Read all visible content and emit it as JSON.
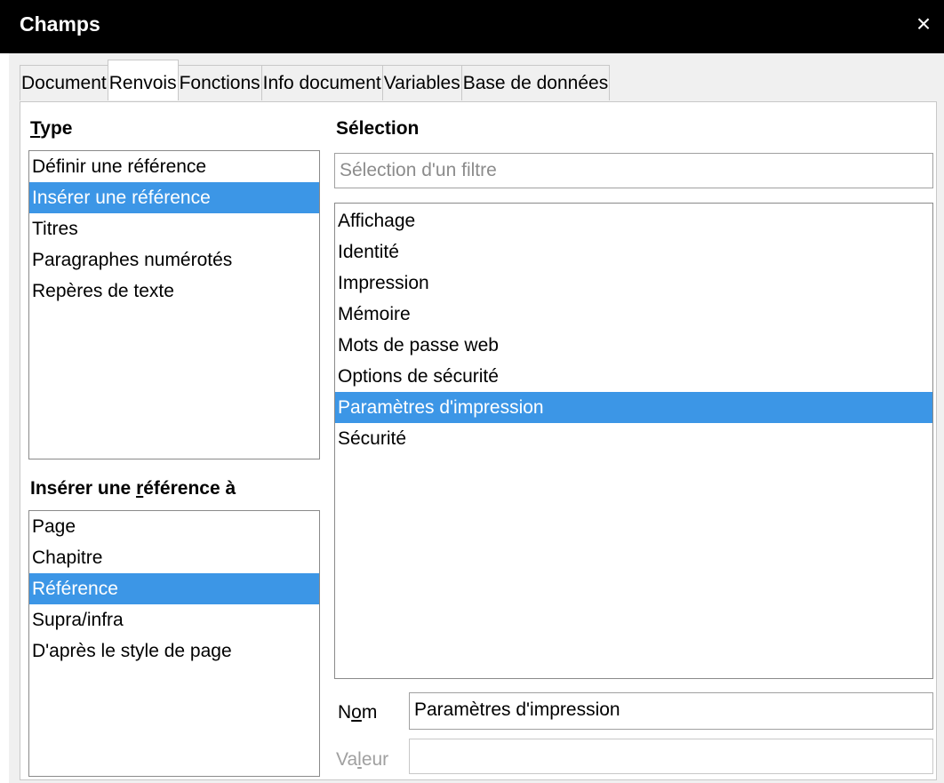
{
  "window": {
    "title": "Champs",
    "close_icon": "×"
  },
  "tabs": [
    {
      "label": "Document"
    },
    {
      "label": "Renvois"
    },
    {
      "label": "Fonctions"
    },
    {
      "label": "Info document"
    },
    {
      "label": "Variables"
    },
    {
      "label": "Base de données"
    }
  ],
  "type": {
    "label_first": "T",
    "label_rest": "ype",
    "items": [
      "Définir une référence",
      "Insérer une référence",
      "Titres",
      "Paragraphes numérotés",
      "Repères de texte"
    ],
    "selected_index": 1
  },
  "insert_ref": {
    "label_before": "Insérer une ",
    "label_underline": "r",
    "label_after": "éférence à",
    "items": [
      "Page",
      "Chapitre",
      "Référence",
      "Supra/infra",
      "D'après le style de page"
    ],
    "selected_index": 2
  },
  "selection": {
    "label": "Sélection",
    "filter_placeholder": "Sélection d'un filtre",
    "items": [
      "Affichage",
      "Identité",
      "Impression",
      "Mémoire",
      "Mots de passe web",
      "Options de sécurité",
      "Paramètres d'impression",
      "Sécurité"
    ],
    "selected_index": 6
  },
  "name_field": {
    "label_before": "N",
    "label_underline": "o",
    "label_after": "m",
    "value": "Paramètres d'impression"
  },
  "value_field": {
    "label_before": "Va",
    "label_underline": "l",
    "label_after": "eur",
    "value": ""
  },
  "colors": {
    "selection": "#3c96e6",
    "titlebar": "#000000"
  }
}
